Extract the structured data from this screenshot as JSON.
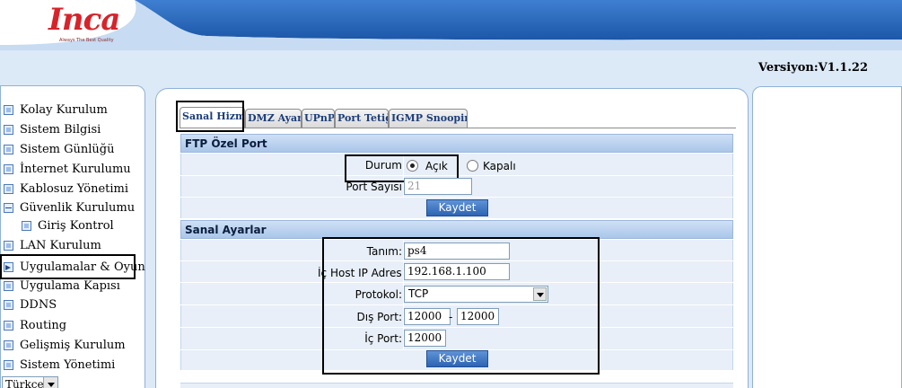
{
  "header": {
    "brand": "Inca",
    "tagline": "Always The Best Quality",
    "version": "Versiyon:V1.1.22"
  },
  "sidebar": {
    "items": [
      {
        "label": "Kolay Kurulum"
      },
      {
        "label": "Sistem Bilgisi"
      },
      {
        "label": "Sistem Günlüğü"
      },
      {
        "label": "İnternet Kurulumu"
      },
      {
        "label": "Kablosuz Yönetimi"
      },
      {
        "label": "Güvenlik Kurulumu"
      },
      {
        "label": "Giriş Kontrol"
      },
      {
        "label": "LAN Kurulum"
      },
      {
        "label": "Uygulamalar & Oyun"
      },
      {
        "label": "Uygulama Kapısı"
      },
      {
        "label": "DDNS"
      },
      {
        "label": "Routing"
      },
      {
        "label": "Gelişmiş Kurulum"
      },
      {
        "label": "Sistem Yönetimi"
      }
    ],
    "active_item": "Uygulamalar & Oyun",
    "language": "Türkçe"
  },
  "tabs": [
    {
      "label": "Sanal Hizmet",
      "active": true
    },
    {
      "label": "DMZ Ayar",
      "active": false
    },
    {
      "label": "UPnP",
      "active": false
    },
    {
      "label": "Port Tetiği",
      "active": false
    },
    {
      "label": "IGMP Snooping",
      "active": false
    }
  ],
  "ftp": {
    "title": "FTP Özel Port",
    "status_label": "Durum",
    "option_on": "Açık",
    "option_off": "Kapalı",
    "selected": "Açık",
    "port_label": "Port Sayısı",
    "port_value": "21",
    "save_label": "Kaydet"
  },
  "virtual": {
    "title": "Sanal Ayarlar",
    "name_label": "Tanım:",
    "name_value": "ps4",
    "host_label": "İç Host IP Adresi",
    "host_value": "192.168.1.100",
    "protocol_label": "Protokol:",
    "protocol_value": "TCP",
    "ext_port_label": "Dış Port:",
    "ext_port_from": "12000",
    "ext_port_sep": "-",
    "ext_port_to": "12000",
    "int_port_label": "İç Port:",
    "int_port_value": "12000",
    "save_label": "Kaydet"
  },
  "colors": {
    "accent": "#2d64b3",
    "header_blue": "#1f5fb5",
    "brand_red": "#d8232a"
  }
}
